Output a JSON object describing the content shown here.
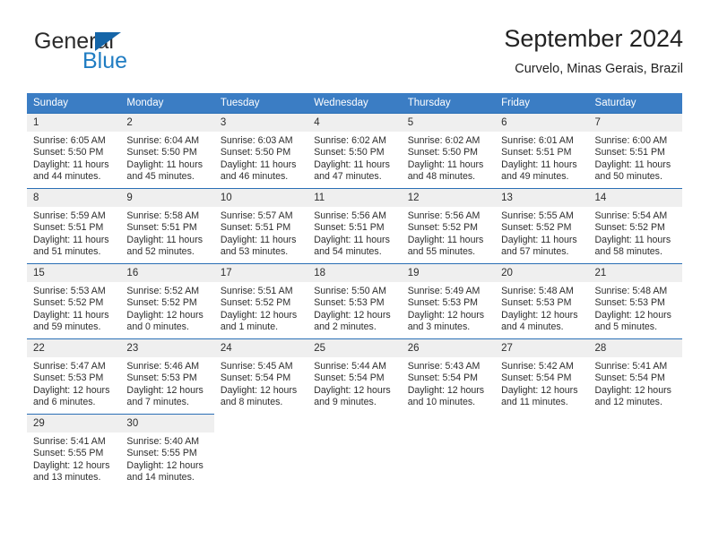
{
  "brand": {
    "name_top": "General",
    "name_bottom": "Blue",
    "triangle_color": "#1565a8",
    "blue_color": "#1f7cc2"
  },
  "header": {
    "title": "September 2024",
    "subtitle": "Curvelo, Minas Gerais, Brazil"
  },
  "theme": {
    "header_bar": "#3b7dc4",
    "cell_top_border": "#2a6fb5",
    "daynum_band": "#efefef",
    "text": "#2d2d2d"
  },
  "calendar": {
    "weekday_headers": [
      "Sunday",
      "Monday",
      "Tuesday",
      "Wednesday",
      "Thursday",
      "Friday",
      "Saturday"
    ],
    "weeks": [
      [
        {
          "day": "1",
          "sunrise": "Sunrise: 6:05 AM",
          "sunset": "Sunset: 5:50 PM",
          "daylight": "Daylight: 11 hours and 44 minutes."
        },
        {
          "day": "2",
          "sunrise": "Sunrise: 6:04 AM",
          "sunset": "Sunset: 5:50 PM",
          "daylight": "Daylight: 11 hours and 45 minutes."
        },
        {
          "day": "3",
          "sunrise": "Sunrise: 6:03 AM",
          "sunset": "Sunset: 5:50 PM",
          "daylight": "Daylight: 11 hours and 46 minutes."
        },
        {
          "day": "4",
          "sunrise": "Sunrise: 6:02 AM",
          "sunset": "Sunset: 5:50 PM",
          "daylight": "Daylight: 11 hours and 47 minutes."
        },
        {
          "day": "5",
          "sunrise": "Sunrise: 6:02 AM",
          "sunset": "Sunset: 5:50 PM",
          "daylight": "Daylight: 11 hours and 48 minutes."
        },
        {
          "day": "6",
          "sunrise": "Sunrise: 6:01 AM",
          "sunset": "Sunset: 5:51 PM",
          "daylight": "Daylight: 11 hours and 49 minutes."
        },
        {
          "day": "7",
          "sunrise": "Sunrise: 6:00 AM",
          "sunset": "Sunset: 5:51 PM",
          "daylight": "Daylight: 11 hours and 50 minutes."
        }
      ],
      [
        {
          "day": "8",
          "sunrise": "Sunrise: 5:59 AM",
          "sunset": "Sunset: 5:51 PM",
          "daylight": "Daylight: 11 hours and 51 minutes."
        },
        {
          "day": "9",
          "sunrise": "Sunrise: 5:58 AM",
          "sunset": "Sunset: 5:51 PM",
          "daylight": "Daylight: 11 hours and 52 minutes."
        },
        {
          "day": "10",
          "sunrise": "Sunrise: 5:57 AM",
          "sunset": "Sunset: 5:51 PM",
          "daylight": "Daylight: 11 hours and 53 minutes."
        },
        {
          "day": "11",
          "sunrise": "Sunrise: 5:56 AM",
          "sunset": "Sunset: 5:51 PM",
          "daylight": "Daylight: 11 hours and 54 minutes."
        },
        {
          "day": "12",
          "sunrise": "Sunrise: 5:56 AM",
          "sunset": "Sunset: 5:52 PM",
          "daylight": "Daylight: 11 hours and 55 minutes."
        },
        {
          "day": "13",
          "sunrise": "Sunrise: 5:55 AM",
          "sunset": "Sunset: 5:52 PM",
          "daylight": "Daylight: 11 hours and 57 minutes."
        },
        {
          "day": "14",
          "sunrise": "Sunrise: 5:54 AM",
          "sunset": "Sunset: 5:52 PM",
          "daylight": "Daylight: 11 hours and 58 minutes."
        }
      ],
      [
        {
          "day": "15",
          "sunrise": "Sunrise: 5:53 AM",
          "sunset": "Sunset: 5:52 PM",
          "daylight": "Daylight: 11 hours and 59 minutes."
        },
        {
          "day": "16",
          "sunrise": "Sunrise: 5:52 AM",
          "sunset": "Sunset: 5:52 PM",
          "daylight": "Daylight: 12 hours and 0 minutes."
        },
        {
          "day": "17",
          "sunrise": "Sunrise: 5:51 AM",
          "sunset": "Sunset: 5:52 PM",
          "daylight": "Daylight: 12 hours and 1 minute."
        },
        {
          "day": "18",
          "sunrise": "Sunrise: 5:50 AM",
          "sunset": "Sunset: 5:53 PM",
          "daylight": "Daylight: 12 hours and 2 minutes."
        },
        {
          "day": "19",
          "sunrise": "Sunrise: 5:49 AM",
          "sunset": "Sunset: 5:53 PM",
          "daylight": "Daylight: 12 hours and 3 minutes."
        },
        {
          "day": "20",
          "sunrise": "Sunrise: 5:48 AM",
          "sunset": "Sunset: 5:53 PM",
          "daylight": "Daylight: 12 hours and 4 minutes."
        },
        {
          "day": "21",
          "sunrise": "Sunrise: 5:48 AM",
          "sunset": "Sunset: 5:53 PM",
          "daylight": "Daylight: 12 hours and 5 minutes."
        }
      ],
      [
        {
          "day": "22",
          "sunrise": "Sunrise: 5:47 AM",
          "sunset": "Sunset: 5:53 PM",
          "daylight": "Daylight: 12 hours and 6 minutes."
        },
        {
          "day": "23",
          "sunrise": "Sunrise: 5:46 AM",
          "sunset": "Sunset: 5:53 PM",
          "daylight": "Daylight: 12 hours and 7 minutes."
        },
        {
          "day": "24",
          "sunrise": "Sunrise: 5:45 AM",
          "sunset": "Sunset: 5:54 PM",
          "daylight": "Daylight: 12 hours and 8 minutes."
        },
        {
          "day": "25",
          "sunrise": "Sunrise: 5:44 AM",
          "sunset": "Sunset: 5:54 PM",
          "daylight": "Daylight: 12 hours and 9 minutes."
        },
        {
          "day": "26",
          "sunrise": "Sunrise: 5:43 AM",
          "sunset": "Sunset: 5:54 PM",
          "daylight": "Daylight: 12 hours and 10 minutes."
        },
        {
          "day": "27",
          "sunrise": "Sunrise: 5:42 AM",
          "sunset": "Sunset: 5:54 PM",
          "daylight": "Daylight: 12 hours and 11 minutes."
        },
        {
          "day": "28",
          "sunrise": "Sunrise: 5:41 AM",
          "sunset": "Sunset: 5:54 PM",
          "daylight": "Daylight: 12 hours and 12 minutes."
        }
      ],
      [
        {
          "day": "29",
          "sunrise": "Sunrise: 5:41 AM",
          "sunset": "Sunset: 5:55 PM",
          "daylight": "Daylight: 12 hours and 13 minutes."
        },
        {
          "day": "30",
          "sunrise": "Sunrise: 5:40 AM",
          "sunset": "Sunset: 5:55 PM",
          "daylight": "Daylight: 12 hours and 14 minutes."
        },
        {
          "day": "",
          "sunrise": "",
          "sunset": "",
          "daylight": ""
        },
        {
          "day": "",
          "sunrise": "",
          "sunset": "",
          "daylight": ""
        },
        {
          "day": "",
          "sunrise": "",
          "sunset": "",
          "daylight": ""
        },
        {
          "day": "",
          "sunrise": "",
          "sunset": "",
          "daylight": ""
        },
        {
          "day": "",
          "sunrise": "",
          "sunset": "",
          "daylight": ""
        }
      ]
    ]
  }
}
